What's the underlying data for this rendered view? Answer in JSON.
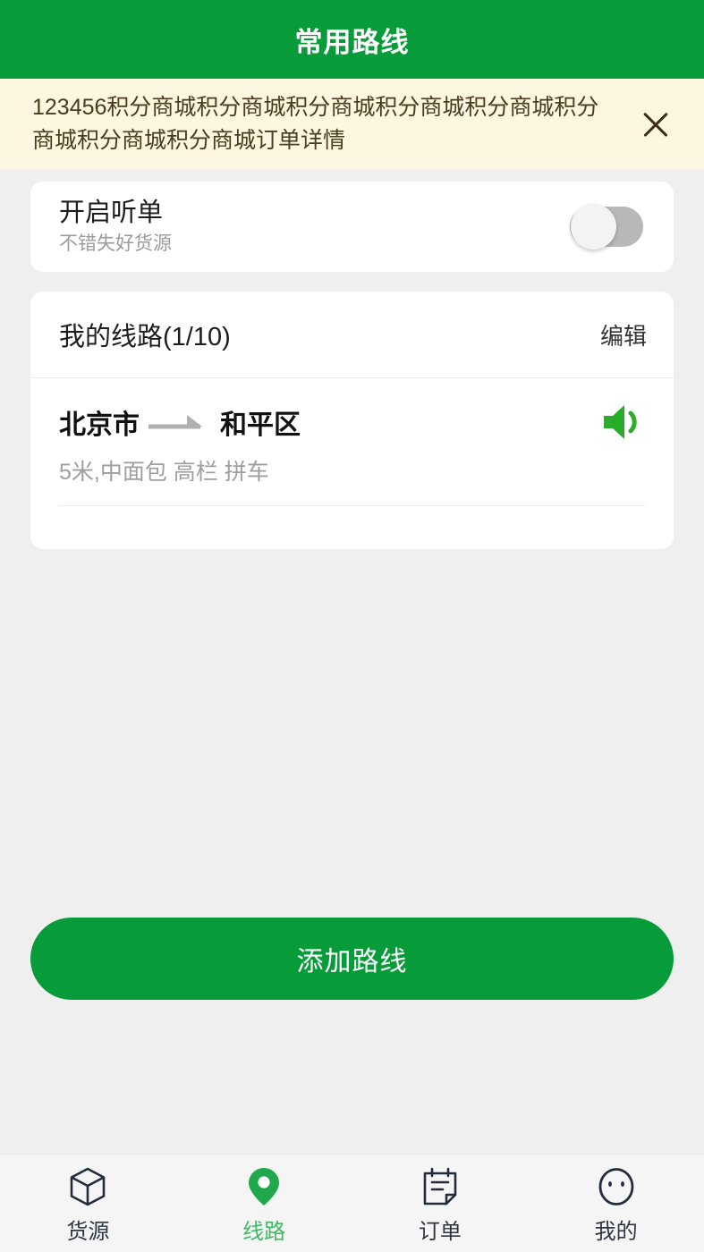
{
  "header": {
    "title": "常用路线"
  },
  "banner": {
    "message": "123456积分商城积分商城积分商城积分商城积分商城积分商城积分商城积分商城订单详情",
    "close_icon": "close-icon"
  },
  "listen_card": {
    "title": "开启听单",
    "subtitle": "不错失好货源",
    "toggle_state": "off"
  },
  "routes_card": {
    "title": "我的线路(1/10)",
    "edit_label": "编辑",
    "routes": [
      {
        "origin": "北京市",
        "destination": "和平区",
        "arrow_icon": "arrow-right-icon",
        "meta": "5米,中面包 高栏 拼车",
        "speaker_icon": "speaker-icon"
      }
    ]
  },
  "add_button": {
    "label": "添加路线"
  },
  "tabbar": {
    "items": [
      {
        "label": "货源",
        "icon": "cube-icon",
        "active": false
      },
      {
        "label": "线路",
        "icon": "location-pin-icon",
        "active": true
      },
      {
        "label": "订单",
        "icon": "clipboard-icon",
        "active": false
      },
      {
        "label": "我的",
        "icon": "face-icon",
        "active": false
      }
    ]
  },
  "colors": {
    "brand_green": "#089b3a",
    "active_green": "#3dba63",
    "banner_bg": "#fdf6e0",
    "page_bg": "#efefef",
    "card_bg": "#ffffff"
  }
}
